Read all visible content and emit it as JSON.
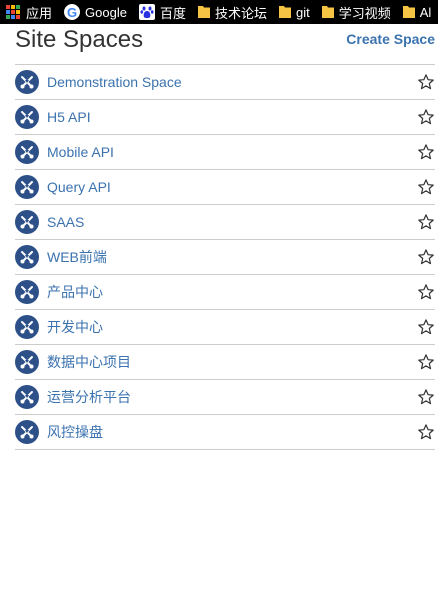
{
  "bookmarks": {
    "items": [
      {
        "label": "应用",
        "icon": "apps-grid-icon"
      },
      {
        "label": "Google",
        "icon": "google-icon"
      },
      {
        "label": "百度",
        "icon": "baidu-paw-icon"
      },
      {
        "label": "技术论坛",
        "icon": "folder-icon"
      },
      {
        "label": "git",
        "icon": "folder-icon"
      },
      {
        "label": "学习视频",
        "icon": "folder-icon"
      },
      {
        "label": "Al",
        "icon": "folder-icon"
      }
    ]
  },
  "page": {
    "title": "Site Spaces",
    "create_label": "Create Space"
  },
  "spaces": [
    {
      "name": "Demonstration Space"
    },
    {
      "name": "H5 API"
    },
    {
      "name": "Mobile API"
    },
    {
      "name": "Query API"
    },
    {
      "name": "SAAS"
    },
    {
      "name": "WEB前端"
    },
    {
      "name": "产品中心"
    },
    {
      "name": "开发中心"
    },
    {
      "name": "数据中心项目"
    },
    {
      "name": "运营分析平台"
    },
    {
      "name": "风控操盘"
    }
  ],
  "colors": {
    "link": "#3b73af",
    "space_icon_bg": "#2c5087",
    "divider": "#cccccc",
    "star": "#333333",
    "folder": "#f5c445"
  },
  "icons": {
    "space": "space-avatar-icon",
    "favourite": "star-outline-icon"
  }
}
